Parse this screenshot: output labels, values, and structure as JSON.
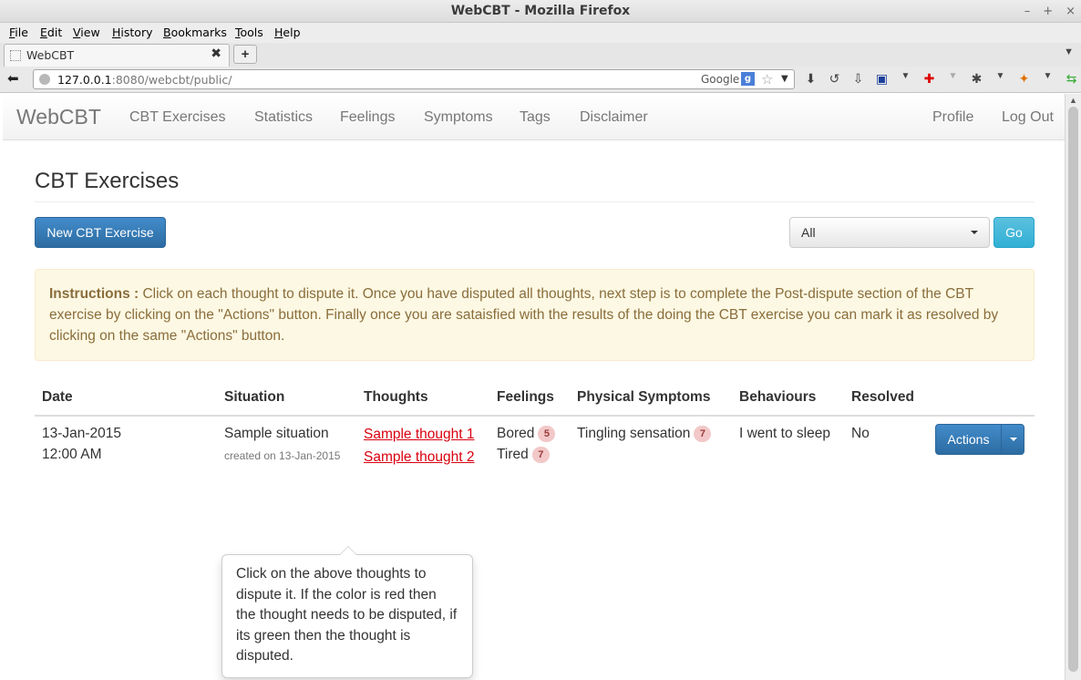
{
  "window": {
    "title": "WebCBT - Mozilla Firefox",
    "controls": [
      "–",
      "+",
      "×"
    ]
  },
  "menu": [
    "File",
    "Edit",
    "View",
    "History",
    "Bookmarks",
    "Tools",
    "Help"
  ],
  "tab": {
    "title": "WebCBT",
    "close": "✖",
    "new": "+"
  },
  "urlbar": {
    "host": "127.0.0.1",
    "rest": ":8080/webcbt/public/",
    "search_engine": "Google"
  },
  "app": {
    "brand": "WebCBT",
    "nav": [
      "CBT Exercises",
      "Statistics",
      "Feelings",
      "Symptoms",
      "Tags",
      "Disclaimer"
    ],
    "nav_right": [
      "Profile",
      "Log Out"
    ]
  },
  "page": {
    "title": "CBT Exercises",
    "new_button": "New CBT Exercise",
    "filter": {
      "selected": "All",
      "go": "Go"
    },
    "instructions_label": "Instructions :",
    "instructions_text": " Click on each thought to dispute it. Once you have disputed all thoughts, next step is to complete the Post-dispute section of the CBT exercise by clicking on the \"Actions\" button. Finally once you are sataisfied with the results of the doing the CBT exercise you can mark it as resolved by clicking on the same \"Actions\" button."
  },
  "table": {
    "headers": [
      "Date",
      "Situation",
      "Thoughts",
      "Feelings",
      "Physical Symptoms",
      "Behaviours",
      "Resolved"
    ],
    "rows": [
      {
        "date": "13-Jan-2015",
        "time": "12:00 AM",
        "situation": "Sample situation",
        "created": "created on 13-Jan-2015",
        "thoughts": [
          "Sample thought 1",
          "Sample thought 2"
        ],
        "feelings": [
          {
            "name": "Bored",
            "count": "5"
          },
          {
            "name": "Tired",
            "count": "7"
          }
        ],
        "symptoms": [
          {
            "name": "Tingling sensation",
            "count": "7"
          }
        ],
        "behaviour": "I went to sleep",
        "resolved": "No",
        "actions": "Actions"
      }
    ]
  },
  "popover": {
    "text": "Click on the above thoughts to dispute it. If the color is red then the thought needs to be disputed, if its green then the thought is disputed."
  },
  "colors": {
    "primary": "#428bca",
    "info": "#5bc0de",
    "undisputed_thought": "#d9000f",
    "alert_bg": "#fcf8e3"
  }
}
